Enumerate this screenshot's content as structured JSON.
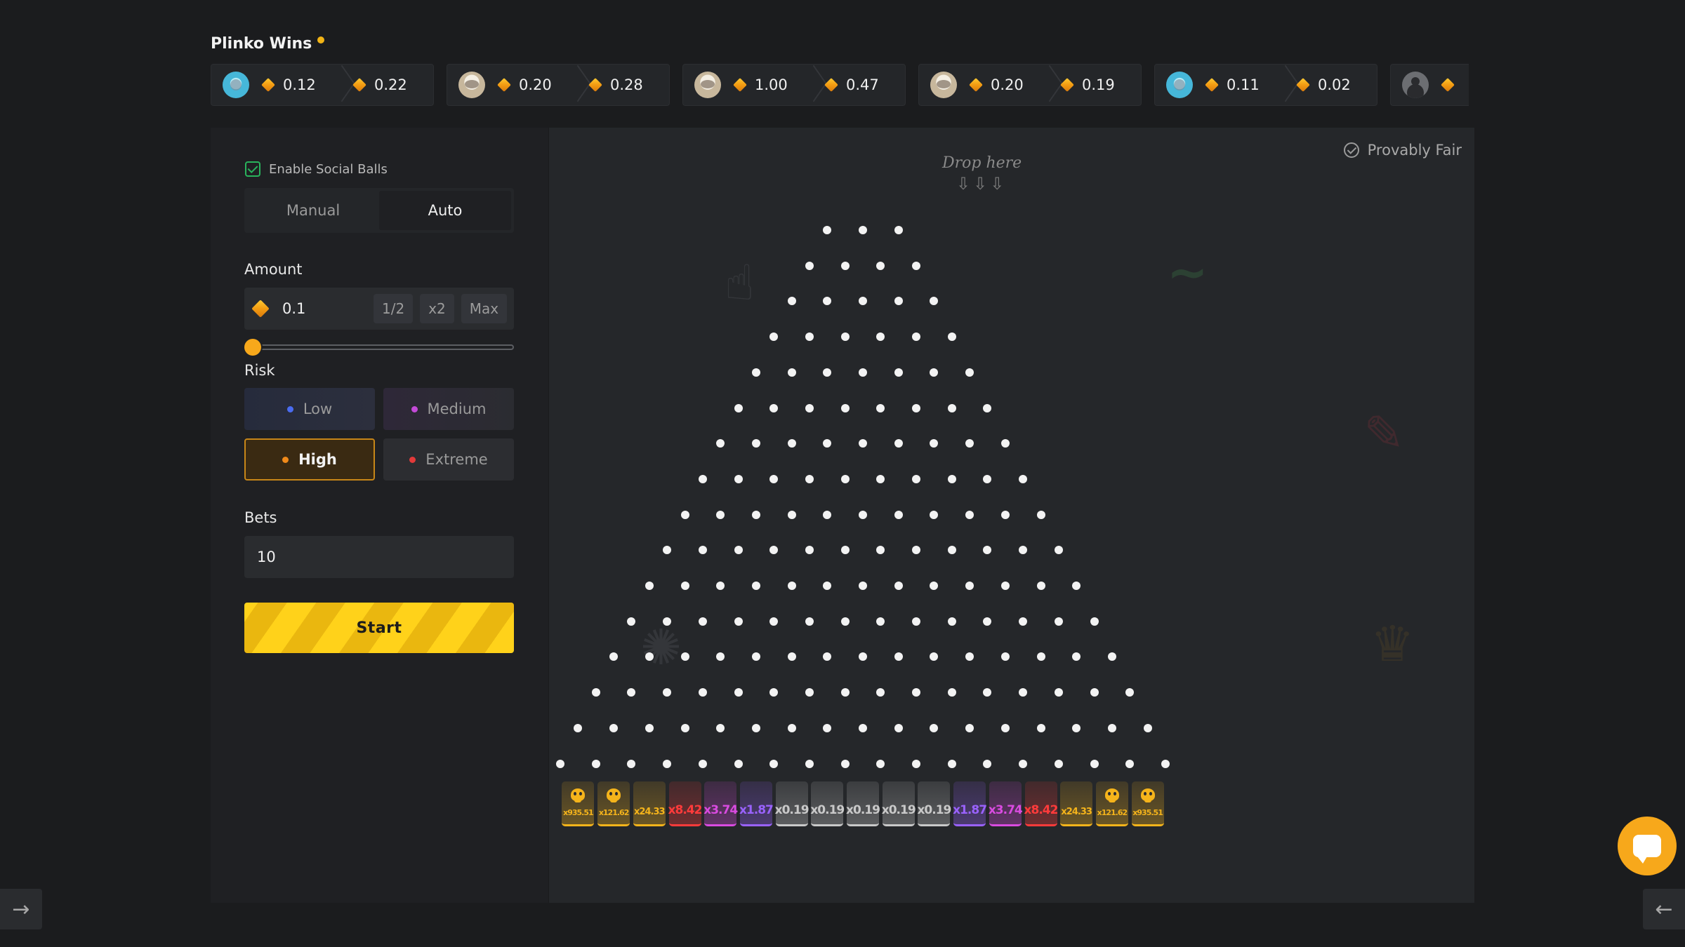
{
  "header": {
    "title": "Plinko Wins",
    "wins": [
      {
        "avatar": "blue",
        "bet": "0.12",
        "payout": "0.22"
      },
      {
        "avatar": "beige",
        "bet": "0.20",
        "payout": "0.28"
      },
      {
        "avatar": "beige",
        "bet": "1.00",
        "payout": "0.47"
      },
      {
        "avatar": "beige",
        "bet": "0.20",
        "payout": "0.19"
      },
      {
        "avatar": "blue",
        "bet": "0.11",
        "payout": "0.02"
      },
      {
        "avatar": "grey",
        "bet": "",
        "payout": ""
      }
    ]
  },
  "controls": {
    "social_label": "Enable Social Balls",
    "social_enabled": true,
    "mode_tabs": [
      "Manual",
      "Auto"
    ],
    "active_mode": "Auto",
    "amount_label": "Amount",
    "amount_value": "0.1",
    "amount_chips": [
      "1/2",
      "x2",
      "Max"
    ],
    "slider_fraction": 0.0,
    "risk_label": "Risk",
    "risk_options": [
      {
        "label": "Low",
        "color": "#4a6cf0"
      },
      {
        "label": "Medium",
        "color": "#c44ad8"
      },
      {
        "label": "High",
        "color": "#f08a1a"
      },
      {
        "label": "Extreme",
        "color": "#e33a3a"
      }
    ],
    "selected_risk": "High",
    "bets_label": "Bets",
    "bets_value": "10",
    "start_label": "Start"
  },
  "board": {
    "provably_fair": "Provably Fair",
    "drop_hint": "Drop here",
    "rows": 16,
    "first_row_pegs": 3,
    "multipliers": [
      {
        "label": "x935.51",
        "color": "#f5b41b",
        "skull": true
      },
      {
        "label": "x121.62",
        "color": "#f5b41b",
        "skull": true
      },
      {
        "label": "x24.33",
        "color": "#f5b41b",
        "skull": false
      },
      {
        "label": "x8.42",
        "color": "#ff3b3b",
        "skull": false
      },
      {
        "label": "x3.74",
        "color": "#d94be0",
        "skull": false
      },
      {
        "label": "x1.87",
        "color": "#9a62ff",
        "skull": false
      },
      {
        "label": "x0.19",
        "color": "#c9c9c9",
        "skull": false
      },
      {
        "label": "x0.19",
        "color": "#c9c9c9",
        "skull": false
      },
      {
        "label": "x0.19",
        "color": "#c9c9c9",
        "skull": false
      },
      {
        "label": "x0.19",
        "color": "#c9c9c9",
        "skull": false
      },
      {
        "label": "x0.19",
        "color": "#c9c9c9",
        "skull": false
      },
      {
        "label": "x1.87",
        "color": "#9a62ff",
        "skull": false
      },
      {
        "label": "x3.74",
        "color": "#d94be0",
        "skull": false
      },
      {
        "label": "x8.42",
        "color": "#ff3b3b",
        "skull": false
      },
      {
        "label": "x24.33",
        "color": "#f5b41b",
        "skull": false
      },
      {
        "label": "x121.62",
        "color": "#f5b41b",
        "skull": true
      },
      {
        "label": "x935.51",
        "color": "#f5b41b",
        "skull": true
      }
    ]
  },
  "icons": {
    "gem": "diamond-gem-icon",
    "expand_left": "→",
    "collapse_right": "←",
    "chat": "chat-bubble-icon"
  }
}
